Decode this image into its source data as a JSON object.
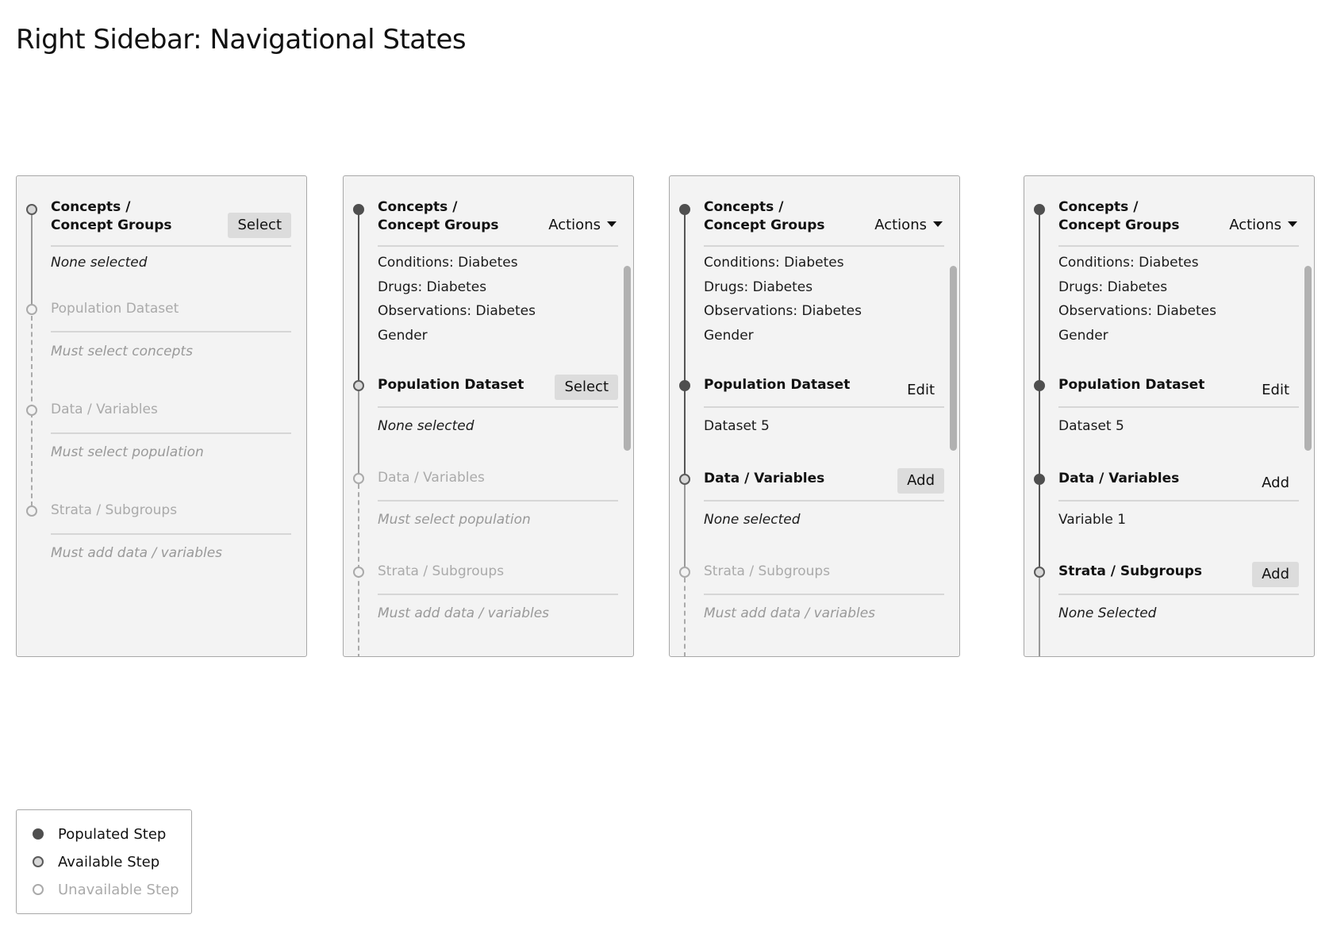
{
  "page": {
    "title": "Right Sidebar: Navigational States"
  },
  "panels": [
    {
      "steps": [
        {
          "title_line1": "Concepts /",
          "title_line2": "Concept Groups",
          "state": "available",
          "action": "Select",
          "action_type": "button",
          "content": [
            "None selected"
          ],
          "content_style": "italic"
        },
        {
          "title": "Population Dataset",
          "state": "unavailable",
          "content": [
            "Must select concepts"
          ],
          "content_style": "muted"
        },
        {
          "title": "Data / Variables",
          "state": "unavailable",
          "content": [
            "Must select population"
          ],
          "content_style": "muted"
        },
        {
          "title": "Strata / Subgroups",
          "state": "unavailable",
          "content": [
            "Must add data / variables"
          ],
          "content_style": "muted"
        }
      ]
    },
    {
      "steps": [
        {
          "title_line1": "Concepts /",
          "title_line2": "Concept Groups",
          "state": "populated",
          "action": "Actions",
          "action_type": "dropdown",
          "content": [
            "Conditions: Diabetes",
            "Drugs: Diabetes",
            "Observations: Diabetes",
            "Gender"
          ],
          "content_style": "normal"
        },
        {
          "title": "Population Dataset",
          "state": "available",
          "action": "Select",
          "action_type": "button",
          "content": [
            "None selected"
          ],
          "content_style": "italic"
        },
        {
          "title": "Data / Variables",
          "state": "unavailable",
          "content": [
            "Must select population"
          ],
          "content_style": "muted"
        },
        {
          "title": "Strata / Subgroups",
          "state": "unavailable",
          "content": [
            "Must add data / variables"
          ],
          "content_style": "muted"
        }
      ]
    },
    {
      "steps": [
        {
          "title_line1": "Concepts /",
          "title_line2": "Concept Groups",
          "state": "populated",
          "action": "Actions",
          "action_type": "dropdown",
          "content": [
            "Conditions: Diabetes",
            "Drugs: Diabetes",
            "Observations: Diabetes",
            "Gender"
          ],
          "content_style": "normal"
        },
        {
          "title": "Population Dataset",
          "state": "populated",
          "action": "Edit",
          "action_type": "link",
          "content": [
            "Dataset 5"
          ],
          "content_style": "normal"
        },
        {
          "title": "Data / Variables",
          "state": "available",
          "action": "Add",
          "action_type": "button",
          "content": [
            "None selected"
          ],
          "content_style": "italic"
        },
        {
          "title": "Strata / Subgroups",
          "state": "unavailable",
          "content": [
            "Must add data / variables"
          ],
          "content_style": "muted"
        }
      ]
    },
    {
      "steps": [
        {
          "title_line1": "Concepts /",
          "title_line2": "Concept Groups",
          "state": "populated",
          "action": "Actions",
          "action_type": "dropdown",
          "content": [
            "Conditions: Diabetes",
            "Drugs: Diabetes",
            "Observations: Diabetes",
            "Gender"
          ],
          "content_style": "normal"
        },
        {
          "title": "Population Dataset",
          "state": "populated",
          "action": "Edit",
          "action_type": "link",
          "content": [
            "Dataset 5"
          ],
          "content_style": "normal"
        },
        {
          "title": "Data / Variables",
          "state": "populated",
          "action": "Add",
          "action_type": "link",
          "content": [
            "Variable 1"
          ],
          "content_style": "normal"
        },
        {
          "title": "Strata / Subgroups",
          "state": "available",
          "action": "Add",
          "action_type": "button",
          "content": [
            "None Selected"
          ],
          "content_style": "italic"
        }
      ]
    }
  ],
  "legend": {
    "items": [
      {
        "label": "Populated Step",
        "state": "populated"
      },
      {
        "label": "Available Step",
        "state": "available"
      },
      {
        "label": "Unavailable Step",
        "state": "unavailable"
      }
    ]
  }
}
